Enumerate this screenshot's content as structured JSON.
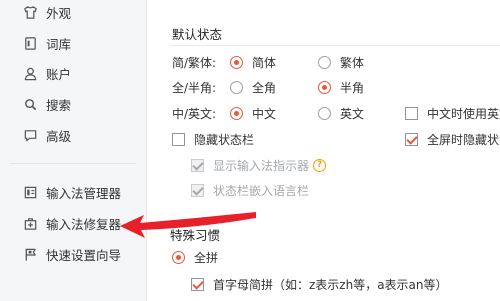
{
  "sidebar": {
    "items": [
      {
        "label": "外观",
        "icon": "shirt-icon"
      },
      {
        "label": "词库",
        "icon": "book-icon"
      },
      {
        "label": "账户",
        "icon": "user-icon"
      },
      {
        "label": "搜索",
        "icon": "search-icon"
      },
      {
        "label": "高级",
        "icon": "chat-icon"
      },
      {
        "label": "输入法管理器",
        "icon": "manager-icon"
      },
      {
        "label": "输入法修复器",
        "icon": "repair-icon"
      },
      {
        "label": "快速设置向导",
        "icon": "flag-icon"
      }
    ]
  },
  "main": {
    "default_state": {
      "title": "默认状态",
      "simp_trad": {
        "label": "简/繁体:",
        "options": [
          "简体",
          "繁体"
        ],
        "selected": "简体"
      },
      "full_half": {
        "label": "全/半角:",
        "options": [
          "全角",
          "半角"
        ],
        "selected": "半角"
      },
      "cn_en": {
        "label": "中/英文:",
        "options": [
          "中文",
          "英文"
        ],
        "selected": "中文",
        "extra_checkbox": "中文时使用英文"
      },
      "hide_status_bar": {
        "label": "隐藏状态栏",
        "checked": false
      },
      "fullscreen_hide": {
        "label": "全屏时隐藏状态",
        "checked": true
      },
      "show_indicator": {
        "label": "显示输入法指示器",
        "checked": true,
        "disabled": true
      },
      "embed_lang_bar": {
        "label": "状态栏嵌入语言栏",
        "checked": true,
        "disabled": true
      }
    },
    "pinyin": {
      "title": "特殊习惯",
      "full_pinyin": {
        "label": "全拼",
        "selected": true
      },
      "initial_abbr": {
        "label": "首字母简拼（如：z表示zh等，a表示an等）",
        "checked": true
      }
    }
  },
  "colors": {
    "accent": "#e35a3c",
    "annotation_arrow": "#e8202a"
  }
}
